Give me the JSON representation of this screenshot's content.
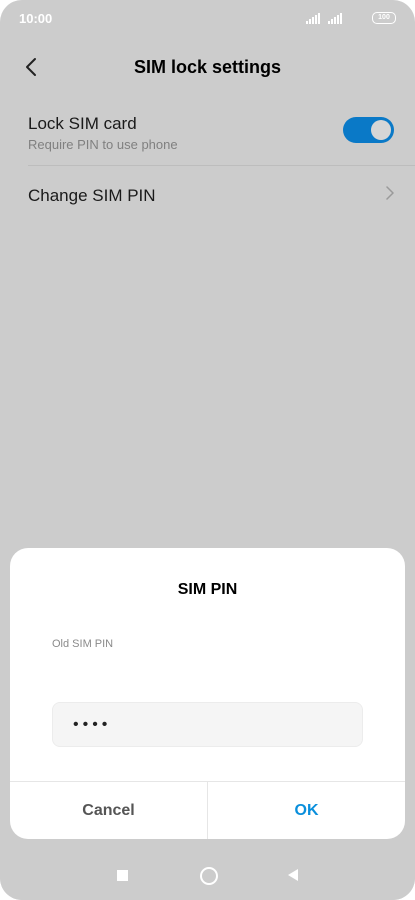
{
  "status_bar": {
    "time": "10:00",
    "battery": "100",
    "signal_icons": [
      "signal-bars-icon",
      "signal-bars-icon"
    ]
  },
  "header": {
    "title": "SIM lock settings",
    "back_icon": "chevron-left-icon"
  },
  "settings": {
    "lock_sim": {
      "title": "Lock SIM card",
      "subtitle": "Require PIN to use phone",
      "toggle_on": true
    },
    "change_pin": {
      "title": "Change SIM PIN",
      "icon": "chevron-right-icon"
    }
  },
  "dialog": {
    "title": "SIM PIN",
    "field_label": "Old SIM PIN",
    "field_value": "••••",
    "cancel_label": "Cancel",
    "ok_label": "OK"
  },
  "nav_bar": {
    "recent_icon": "square-icon",
    "home_icon": "circle-icon",
    "back_icon": "triangle-back-icon"
  },
  "colors": {
    "accent": "#0a79c7",
    "ok_text": "#0a8fdc",
    "overlay": "#cccccc"
  }
}
